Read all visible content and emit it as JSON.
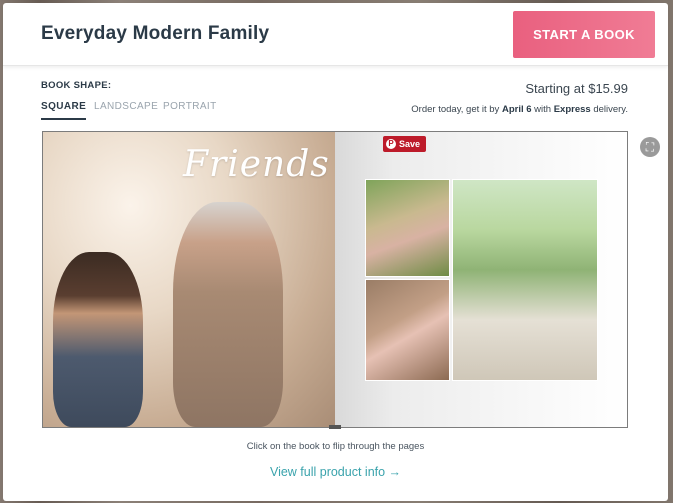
{
  "header": {
    "title": "Everyday Modern Family",
    "start_button": "START A BOOK"
  },
  "book_shape": {
    "label": "BOOK SHAPE:",
    "tabs": [
      {
        "label": "SQUARE",
        "active": true
      },
      {
        "label": "LANDSCAPE",
        "active": false
      },
      {
        "label": "PORTRAIT",
        "active": false
      }
    ]
  },
  "pricing": {
    "price": "Starting at $15.99",
    "delivery_prefix": "Order today, get it by ",
    "delivery_date": "April 6",
    "delivery_mid": " with ",
    "delivery_method": "Express",
    "delivery_suffix": " delivery."
  },
  "book_preview": {
    "page_title": "Friends",
    "save_label": "Save"
  },
  "footer": {
    "hint": "Click on the book to flip through the pages",
    "product_link": "View full product info →"
  },
  "colors": {
    "accent": "#e9607f",
    "link": "#3aa3ac",
    "title": "#2b3a47",
    "pinterest": "#bd1b2a"
  },
  "icons": [
    "pinterest-icon",
    "expand-icon"
  ]
}
